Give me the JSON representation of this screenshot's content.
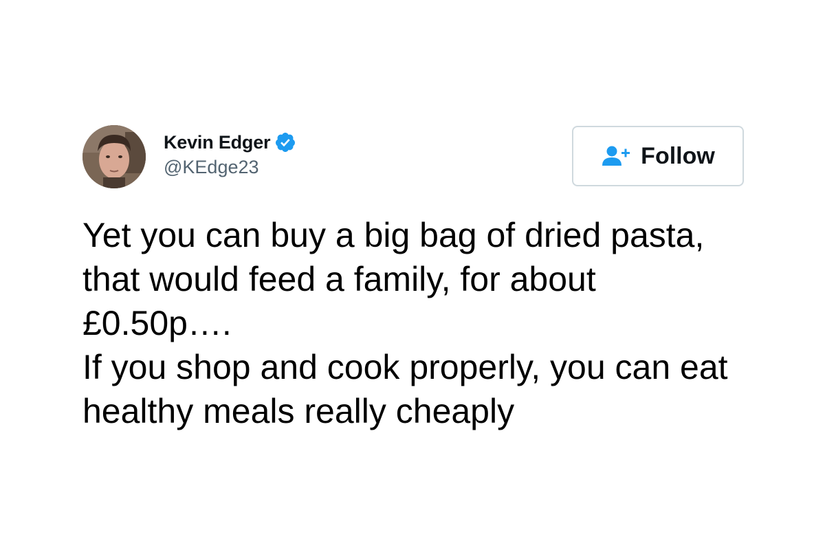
{
  "author": {
    "display_name": "Kevin Edger",
    "handle": "@KEdge23",
    "verified": true,
    "verified_color": "#1d9bf0"
  },
  "follow_button": {
    "label": "Follow",
    "icon": "add-user-icon",
    "icon_color": "#1d9bf0"
  },
  "tweet": {
    "paragraphs": [
      "Yet you can buy a big bag of dried pasta, that would feed a family, for about £0.50p….",
      "If you shop and cook properly, you can eat healthy meals really cheaply"
    ]
  }
}
